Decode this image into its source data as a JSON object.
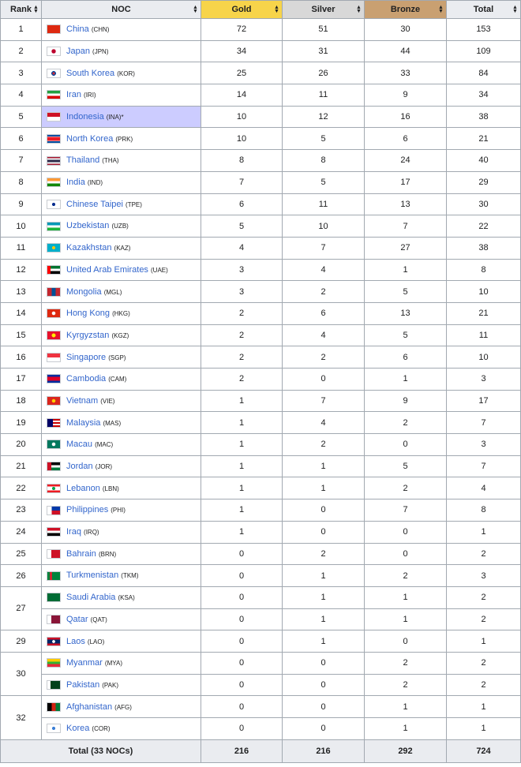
{
  "header": {
    "rank": "Rank",
    "noc": "NOC",
    "gold": "Gold",
    "silver": "Silver",
    "bronze": "Bronze",
    "total": "Total"
  },
  "rows": [
    {
      "rank": "1",
      "country": "China",
      "code": "(CHN)",
      "gold": "72",
      "silver": "51",
      "bronze": "30",
      "total": "153",
      "flag": "linear-gradient(#de2910,#de2910)"
    },
    {
      "rank": "2",
      "country": "Japan",
      "code": "(JPN)",
      "gold": "34",
      "silver": "31",
      "bronze": "44",
      "total": "109",
      "flag": "radial-gradient(circle, #bc002d 0 28%, #ffffff 30%)"
    },
    {
      "rank": "3",
      "country": "South Korea",
      "code": "(KOR)",
      "gold": "25",
      "silver": "26",
      "bronze": "33",
      "total": "84",
      "flag": "radial-gradient(circle, #cd2e3a 0 18%, #0047a0 19% 30%, #ffffff 32%)"
    },
    {
      "rank": "4",
      "country": "Iran",
      "code": "(IRI)",
      "gold": "14",
      "silver": "11",
      "bronze": "9",
      "total": "34",
      "flag": "linear-gradient(#239f40 0 33%, #ffffff 33% 66%, #da0000 66%)"
    },
    {
      "rank": "5",
      "country": "Indonesia",
      "code": "(INA)",
      "host": "*",
      "gold": "10",
      "silver": "12",
      "bronze": "16",
      "total": "38",
      "flag": "linear-gradient(#ce1126 0 50%, #ffffff 50%)"
    },
    {
      "rank": "6",
      "country": "North Korea",
      "code": "(PRK)",
      "gold": "10",
      "silver": "5",
      "bronze": "6",
      "total": "21",
      "flag": "linear-gradient(#024fa2 0 18%, #ffffff 18% 24%, #ed1c27 24% 76%, #ffffff 76% 82%, #024fa2 82%)"
    },
    {
      "rank": "7",
      "country": "Thailand",
      "code": "(THA)",
      "gold": "8",
      "silver": "8",
      "bronze": "24",
      "total": "40",
      "flag": "linear-gradient(#a51931 0 17%, #f4f5f8 17% 33%, #2d2a4a 33% 67%, #f4f5f8 67% 83%, #a51931 83%)"
    },
    {
      "rank": "8",
      "country": "India",
      "code": "(IND)",
      "gold": "7",
      "silver": "5",
      "bronze": "17",
      "total": "29",
      "flag": "linear-gradient(#ff9933 0 33%, #ffffff 33% 66%, #138808 66%)"
    },
    {
      "rank": "9",
      "country": "Chinese Taipei",
      "code": "(TPE)",
      "gold": "6",
      "silver": "11",
      "bronze": "13",
      "total": "30",
      "flag": "radial-gradient(circle, #002d8f 0 20%, #ffffff 24%)"
    },
    {
      "rank": "10",
      "country": "Uzbekistan",
      "code": "(UZB)",
      "gold": "5",
      "silver": "10",
      "bronze": "7",
      "total": "22",
      "flag": "linear-gradient(#0099b5 0 33%, #ce1126 33% 37%, #ffffff 37% 63%, #ce1126 63% 67%, #1eb53a 67%)"
    },
    {
      "rank": "11",
      "country": "Kazakhstan",
      "code": "(KAZ)",
      "gold": "4",
      "silver": "7",
      "bronze": "27",
      "total": "38",
      "flag": "radial-gradient(circle, #fec50c 0 20%, #00afca 24%)"
    },
    {
      "rank": "12",
      "country": "United Arab Emirates",
      "code": "(UAE)",
      "gold": "3",
      "silver": "4",
      "bronze": "1",
      "total": "8",
      "flag": "linear-gradient(90deg, #ff0000 0 25%, transparent 25%), linear-gradient(#00732f 0 33%, #ffffff 33% 66%, #000000 66%)"
    },
    {
      "rank": "13",
      "country": "Mongolia",
      "code": "(MGL)",
      "gold": "3",
      "silver": "2",
      "bronze": "5",
      "total": "10",
      "flag": "linear-gradient(90deg, #c4272f 0 33%, #015197 33% 66%, #c4272f 66%)"
    },
    {
      "rank": "14",
      "country": "Hong Kong",
      "code": "(HKG)",
      "gold": "2",
      "silver": "6",
      "bronze": "13",
      "total": "21",
      "flag": "radial-gradient(circle, #ffffff 0 22%, #de2910 26%)"
    },
    {
      "rank": "15",
      "country": "Kyrgyzstan",
      "code": "(KGZ)",
      "gold": "2",
      "silver": "4",
      "bronze": "5",
      "total": "11",
      "flag": "radial-gradient(circle, #ffef00 0 24%, #e8112d 28%)"
    },
    {
      "rank": "16",
      "country": "Singapore",
      "code": "(SGP)",
      "gold": "2",
      "silver": "2",
      "bronze": "6",
      "total": "10",
      "flag": "linear-gradient(#ef3340 0 50%, #ffffff 50%)"
    },
    {
      "rank": "17",
      "country": "Cambodia",
      "code": "(CAM)",
      "gold": "2",
      "silver": "0",
      "bronze": "1",
      "total": "3",
      "flag": "linear-gradient(#032ea1 0 25%, #e00025 25% 75%, #032ea1 75%)"
    },
    {
      "rank": "18",
      "country": "Vietnam",
      "code": "(VIE)",
      "gold": "1",
      "silver": "7",
      "bronze": "9",
      "total": "17",
      "flag": "radial-gradient(circle, #ffcd00 0 22%, #da251d 26%)"
    },
    {
      "rank": "19",
      "country": "Malaysia",
      "code": "(MAS)",
      "gold": "1",
      "silver": "4",
      "bronze": "2",
      "total": "7",
      "flag": "linear-gradient(90deg, #010066 0 45%, transparent 45%), repeating-linear-gradient(#cc0001 0 2px, #ffffff 2px 4px)"
    },
    {
      "rank": "20",
      "country": "Macau",
      "code": "(MAC)",
      "gold": "1",
      "silver": "2",
      "bronze": "0",
      "total": "3",
      "flag": "radial-gradient(circle, #ffffff 0 22%, #00785e 26%)"
    },
    {
      "rank": "21",
      "country": "Jordan",
      "code": "(JOR)",
      "gold": "1",
      "silver": "1",
      "bronze": "5",
      "total": "7",
      "flag": "linear-gradient(90deg, #ce1126 0 30%, transparent 30%), linear-gradient(#000000 0 33%, #ffffff 33% 66%, #007a3d 66%)"
    },
    {
      "rank": "22",
      "country": "Lebanon",
      "code": "(LBN)",
      "gold": "1",
      "silver": "1",
      "bronze": "2",
      "total": "4",
      "flag": "radial-gradient(circle, #00a651 0 20%, transparent 24%), linear-gradient(#ed1c24 0 25%, #ffffff 25% 75%, #ed1c24 75%)"
    },
    {
      "rank": "23",
      "country": "Philippines",
      "code": "(PHI)",
      "gold": "1",
      "silver": "0",
      "bronze": "7",
      "total": "8",
      "flag": "linear-gradient(90deg, #ffffff 0 35%, transparent 35%), linear-gradient(#0038a8 0 50%, #ce1126 50%)"
    },
    {
      "rank": "24",
      "country": "Iraq",
      "code": "(IRQ)",
      "gold": "1",
      "silver": "0",
      "bronze": "0",
      "total": "1",
      "flag": "linear-gradient(#ce1126 0 33%, #ffffff 33% 66%, #000000 66%)"
    },
    {
      "rank": "25",
      "country": "Bahrain",
      "code": "(BRN)",
      "gold": "0",
      "silver": "2",
      "bronze": "0",
      "total": "2",
      "flag": "linear-gradient(90deg, #ffffff 0 30%, #ce1126 30%)"
    },
    {
      "rank": "26",
      "country": "Turkmenistan",
      "code": "(TKM)",
      "gold": "0",
      "silver": "1",
      "bronze": "2",
      "total": "3",
      "flag": "linear-gradient(90deg, #00843d 0 20%, #d22630 20% 36%, #00843d 36%)"
    },
    {
      "rank": "27",
      "rowspan": 2,
      "country": "Saudi Arabia",
      "code": "(KSA)",
      "gold": "0",
      "silver": "1",
      "bronze": "1",
      "total": "2",
      "flag": "linear-gradient(#006c35,#006c35)"
    },
    {
      "rank": "",
      "skip_rank": true,
      "country": "Qatar",
      "code": "(QAT)",
      "gold": "0",
      "silver": "1",
      "bronze": "1",
      "total": "2",
      "flag": "linear-gradient(90deg, #ffffff 0 30%, #8a1538 30%)"
    },
    {
      "rank": "29",
      "country": "Laos",
      "code": "(LAO)",
      "gold": "0",
      "silver": "1",
      "bronze": "0",
      "total": "1",
      "flag": "radial-gradient(circle, #ffffff 0 18%, transparent 22%), linear-gradient(#ce1126 0 25%, #002868 25% 75%, #ce1126 75%)"
    },
    {
      "rank": "30",
      "rowspan": 2,
      "country": "Myanmar",
      "code": "(MYA)",
      "gold": "0",
      "silver": "0",
      "bronze": "2",
      "total": "2",
      "flag": "linear-gradient(#fecb00 0 33%, #34b233 33% 66%, #ea2839 66%)"
    },
    {
      "rank": "",
      "skip_rank": true,
      "country": "Pakistan",
      "code": "(PAK)",
      "gold": "0",
      "silver": "0",
      "bronze": "2",
      "total": "2",
      "flag": "linear-gradient(90deg, #ffffff 0 25%, #01411c 25%)"
    },
    {
      "rank": "32",
      "rowspan": 2,
      "country": "Afghanistan",
      "code": "(AFG)",
      "gold": "0",
      "silver": "0",
      "bronze": "1",
      "total": "1",
      "flag": "linear-gradient(90deg, #000000 0 33%, #d32011 33% 66%, #007a36 66%)"
    },
    {
      "rank": "",
      "skip_rank": true,
      "country": "Korea",
      "code": "(COR)",
      "gold": "0",
      "silver": "0",
      "bronze": "1",
      "total": "1",
      "flag": "radial-gradient(circle, #3b7fd6 0 20%, #ffffff 24%)"
    }
  ],
  "footer": {
    "label": "Total (33 NOCs)",
    "gold": "216",
    "silver": "216",
    "bronze": "292",
    "total": "724"
  }
}
